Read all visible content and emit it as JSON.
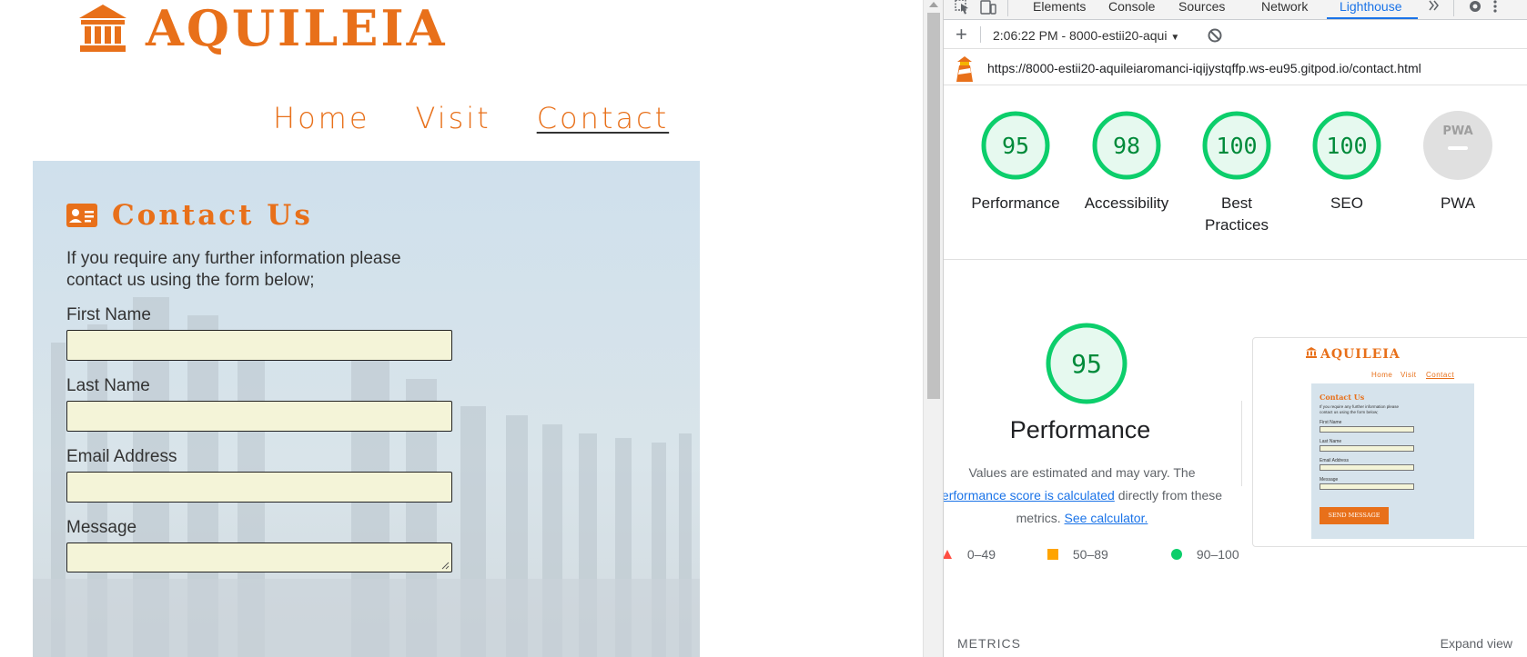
{
  "site": {
    "brand": "AQUILEIA",
    "nav": [
      {
        "label": "Home"
      },
      {
        "label": "Visit"
      },
      {
        "label": "Contact"
      }
    ],
    "contact": {
      "title": "Contact Us",
      "intro": "If you require any further information please contact us using the form below;",
      "fields": [
        {
          "label": "First Name",
          "value": "",
          "placeholder": ""
        },
        {
          "label": "Last Name",
          "value": "",
          "placeholder": ""
        },
        {
          "label": "Email Address",
          "value": "",
          "placeholder": ""
        },
        {
          "label": "Message",
          "value": "",
          "placeholder": ""
        }
      ]
    },
    "accent_color": "#e8701a"
  },
  "devtools": {
    "tabs": [
      "Elements",
      "Console",
      "Sources",
      "Network",
      "Lighthouse"
    ],
    "active_tab": "Lighthouse",
    "session": "2:06:22 PM - 8000-estii20-aqui",
    "url": "https://8000-estii20-aquileiaromanci-iqijystqffp.ws-eu95.gitpod.io/contact.html",
    "scores": [
      {
        "label": "Performance",
        "value": "95"
      },
      {
        "label": "Accessibility",
        "value": "98"
      },
      {
        "label": "Best Practices",
        "value": "100"
      },
      {
        "label": "SEO",
        "value": "100"
      },
      {
        "label": "PWA",
        "value": "PWA"
      }
    ],
    "performance": {
      "score": "95",
      "title": "Performance",
      "desc_1": "Values are estimated and may vary. The",
      "desc_link": "erformance score is calculated",
      "desc_2": "directly from these metrics.",
      "calc_link": "See calculator."
    },
    "legend": [
      {
        "range": "0–49",
        "color": "#ff4e42"
      },
      {
        "range": "50–89",
        "color": "#ffa400"
      },
      {
        "range": "90–100",
        "color": "#0cce6b"
      }
    ],
    "thumbnail": {
      "brand": "AQUILEIA",
      "nav": [
        "Home",
        "Visit",
        "Contact"
      ],
      "title": "Contact Us",
      "intro": "If you require any further information please contact us using the form below;",
      "labels": [
        "First Name",
        "Last Name",
        "Email Address",
        "Message"
      ],
      "button": "SEND MESSAGE"
    },
    "metrics_label": "METRICS",
    "expand_label": "Expand view",
    "score_color": "#0cce6b"
  }
}
